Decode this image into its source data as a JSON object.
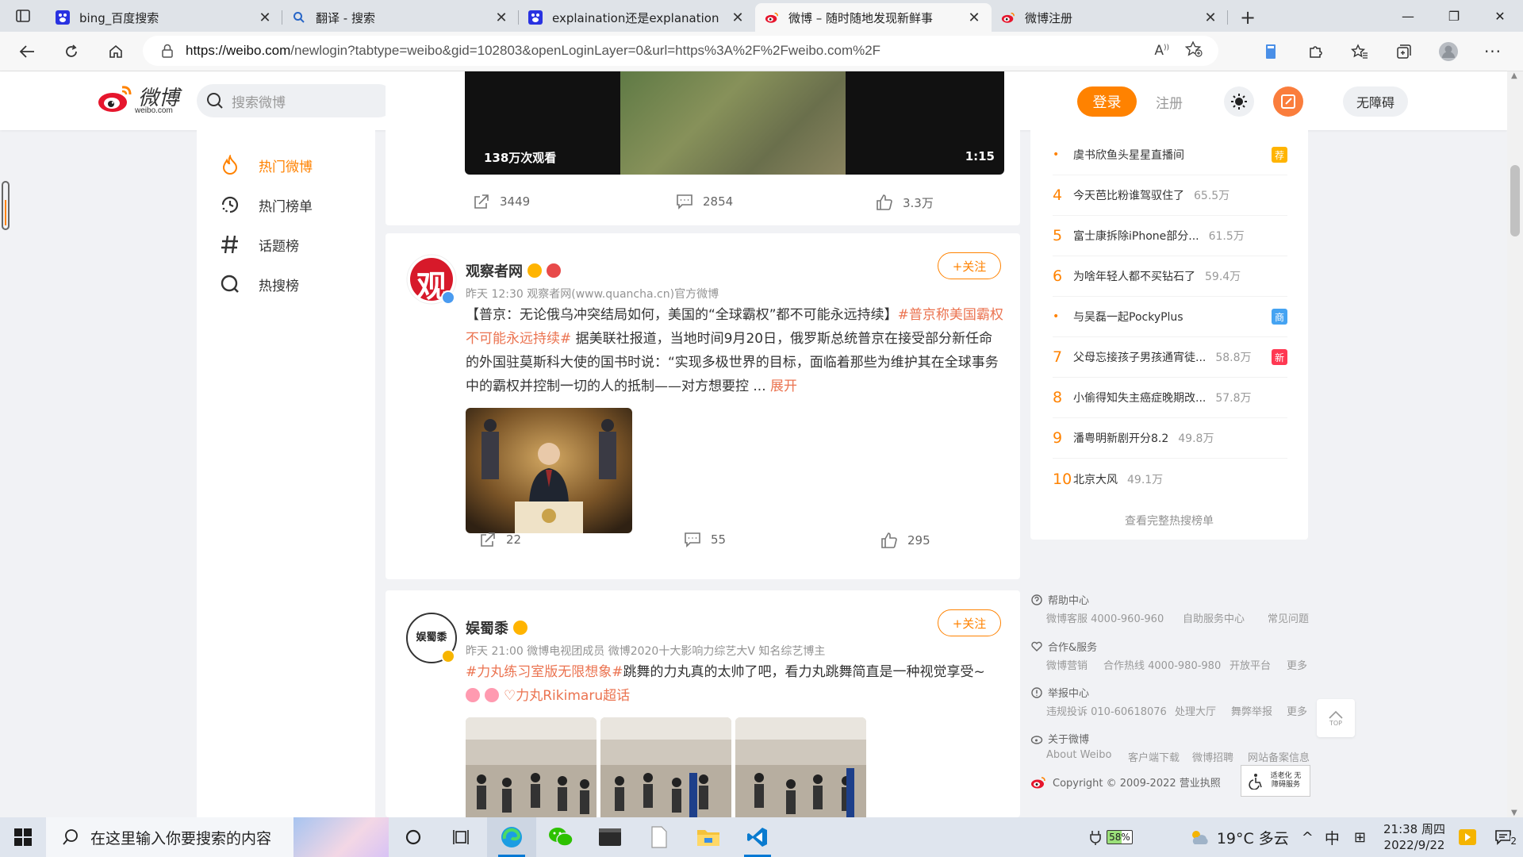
{
  "browser": {
    "tabs": [
      {
        "title": "bing_百度搜索",
        "active": false,
        "icon": "baidu-icon"
      },
      {
        "title": "翻译 - 搜索",
        "active": false,
        "icon": "bing-search-icon"
      },
      {
        "title": "explaination还是explanation",
        "active": false,
        "icon": "baidu-icon"
      },
      {
        "title": "微博 – 随时随地发现新鲜事",
        "active": true,
        "icon": "weibo-icon"
      },
      {
        "title": "微博注册",
        "active": false,
        "icon": "weibo-icon"
      }
    ],
    "url_host": "https://weibo.com",
    "url_path": "/newlogin?tabtype=weibo&gid=102803&openLoginLayer=0&url=https%3A%2F%2Fweibo.com%2F"
  },
  "header": {
    "logo_zh": "微博",
    "logo_en": "weibo.com",
    "search_placeholder": "搜索微博",
    "login_label": "登录",
    "register_label": "注册",
    "accessibility_label": "无障碍"
  },
  "left_nav": [
    {
      "label": "热门微博",
      "icon": "fire-icon",
      "active": true
    },
    {
      "label": "热门榜单",
      "icon": "clock-icon",
      "active": false
    },
    {
      "label": "话题榜",
      "icon": "hashtag-icon",
      "active": false
    },
    {
      "label": "热搜榜",
      "icon": "search-ring-icon",
      "active": false
    }
  ],
  "post0": {
    "video_views": "138万次观看",
    "video_duration": "1:15",
    "reposts": "3449",
    "comments": "2854",
    "likes": "3.3万"
  },
  "post1": {
    "author": "观察者网",
    "avatar_char": "观",
    "meta": "昨天 12:30  观察者网(www.quancha.cn)官方微博",
    "follow_label": "+关注",
    "text_pre": "【普京：无论俄乌冲突结局如何，美国的“全球霸权”都不可能永远持续】",
    "text_tag": "#普京称美国霸权不可能永远持续#",
    "text_post": " 据美联社报道，当地时间9月20日，俄罗斯总统普京在接受部分新任命的外国驻莫斯科大使的国书时说：“实现多极世界的目标，面临着那些为维护其在全球事务中的霸权并控制一切的人的抵制——对方想要控 ... ",
    "expand_label": "展开",
    "reposts": "22",
    "comments": "55",
    "likes": "295"
  },
  "post2": {
    "author": "娱蜀黍",
    "avatar_text": "娱蜀黍",
    "meta": "昨天 21:00  微博电视团成员  微博2020十大影响力综艺大V 知名综艺博主",
    "follow_label": "+关注",
    "text_tag": "#力丸练习室版无限想象#",
    "text_main": "跳舞的力丸真的太帅了吧，看力丸跳舞简直是一种视觉享受~",
    "text_link": "力丸Rikimaru超话"
  },
  "hot_list": {
    "rows": [
      {
        "rank": "•",
        "title": "虞书欣鱼头星星直播间",
        "count": "",
        "badge": "荐",
        "badge_color": "#ffb400"
      },
      {
        "rank": "4",
        "title": "今天芭比粉谁驾驭住了",
        "count": "65.5万",
        "badge": "",
        "badge_color": ""
      },
      {
        "rank": "5",
        "title": "富士康拆除iPhone部分...",
        "count": "61.5万",
        "badge": "",
        "badge_color": ""
      },
      {
        "rank": "6",
        "title": "为啥年轻人都不买钻石了",
        "count": "59.4万",
        "badge": "",
        "badge_color": ""
      },
      {
        "rank": "•",
        "title": "与吴磊一起PockyPlus",
        "count": "",
        "badge": "商",
        "badge_color": "#45a3f2"
      },
      {
        "rank": "7",
        "title": "父母忘接孩子男孩通宵徒...",
        "count": "58.8万",
        "badge": "新",
        "badge_color": "#ff3852"
      },
      {
        "rank": "8",
        "title": "小偷得知失主癌症晚期改...",
        "count": "57.8万",
        "badge": "",
        "badge_color": ""
      },
      {
        "rank": "9",
        "title": "潘粤明新剧开分8.2",
        "count": "49.8万",
        "badge": "",
        "badge_color": ""
      },
      {
        "rank": "10",
        "title": "北京大风",
        "count": "49.1万",
        "badge": "",
        "badge_color": ""
      }
    ],
    "more_label": "查看完整热搜榜单"
  },
  "footer": {
    "help_title": "帮助中心",
    "help_links": [
      "微博客服 4000-960-960",
      "自助服务中心",
      "常见问题"
    ],
    "coop_title": "合作&服务",
    "coop_links": [
      "微博营销",
      "合作热线 4000-980-980",
      "开放平台",
      "更多"
    ],
    "report_title": "举报中心",
    "report_links": [
      "违规投诉 010-60618076",
      "处理大厅",
      "舞弊举报",
      "更多"
    ],
    "about_title": "关于微博",
    "about_links": [
      "About Weibo",
      "客户端下载",
      "微博招聘",
      "网站备案信息"
    ],
    "copyright": "Copyright © 2009-2022 营业执照",
    "gov_badge": "适老化 无障碍服务",
    "top_label": "TOP"
  },
  "taskbar": {
    "search_placeholder": "在这里输入你要搜索的内容",
    "battery": "58%",
    "weather": "19°C  多云",
    "ime": "中",
    "time": "21:38 周四",
    "date": "2022/9/22",
    "notif_count": "2"
  },
  "colors": {
    "accent": "#ff8200",
    "tag": "#eb7350"
  }
}
